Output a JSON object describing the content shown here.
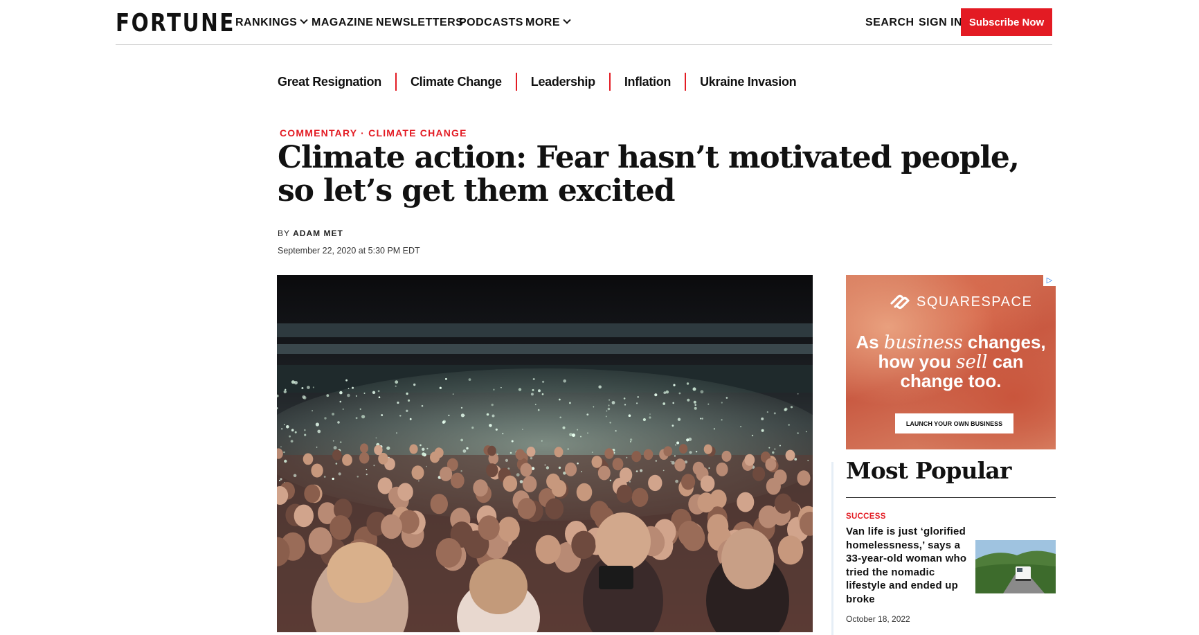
{
  "nav": {
    "logo": "FORTUNE",
    "items": [
      {
        "label": "RANKINGS",
        "dropdown": true
      },
      {
        "label": "MAGAZINE",
        "dropdown": false
      },
      {
        "label": "NEWSLETTERS",
        "dropdown": false
      },
      {
        "label": "PODCASTS",
        "dropdown": false
      },
      {
        "label": "MORE",
        "dropdown": true
      }
    ],
    "search": "SEARCH",
    "sign_in": "SIGN IN",
    "subscribe": "Subscribe Now"
  },
  "topics": [
    "Great Resignation",
    "Climate Change",
    "Leadership",
    "Inflation",
    "Ukraine Invasion"
  ],
  "article": {
    "kicker_section": "COMMENTARY",
    "kicker_separator": "·",
    "kicker_topic": "CLIMATE CHANGE",
    "headline": "Climate action: Fear hasn’t motivated people, so let’s get them excited",
    "byline_prefix": "BY",
    "author": "ADAM MET",
    "date": "September 22, 2020 at 5:30 PM EDT"
  },
  "ad": {
    "brand": "SQUARESPACE",
    "headline_line1_a": "As ",
    "headline_line1_em": "business",
    "headline_line1_b": " changes,",
    "headline_line2_a": "how you ",
    "headline_line2_em": "sell",
    "headline_line2_b": " can",
    "headline_line3": "change too.",
    "cta": "LAUNCH YOUR OWN BUSINESS",
    "badge_icon": "ad-choices-icon"
  },
  "most_popular": {
    "title": "Most Popular",
    "item": {
      "category": "SUCCESS",
      "headline": "Van life is just ‘glorified homelessness,’ says a 33-year-old woman who tried the nomadic lifestyle and ended up broke",
      "date": "October 18, 2022"
    }
  },
  "colors": {
    "accent": "#e31b23",
    "text": "#111111"
  }
}
